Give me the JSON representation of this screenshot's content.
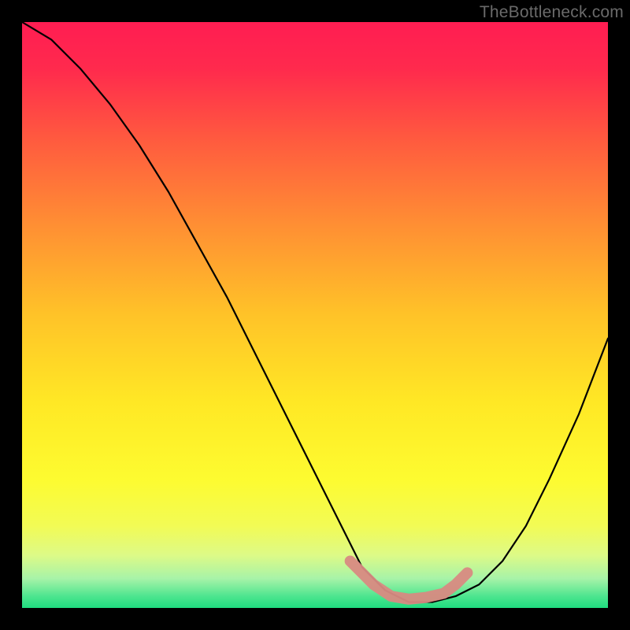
{
  "watermark": "TheBottleneck.com",
  "chart_data": {
    "type": "line",
    "title": "",
    "xlabel": "",
    "ylabel": "",
    "xlim": [
      0,
      100
    ],
    "ylim": [
      0,
      100
    ],
    "grid": false,
    "legend": false,
    "background_gradient": {
      "stops": [
        {
          "offset": 0,
          "color": "#ff1d52"
        },
        {
          "offset": 8,
          "color": "#ff2a4d"
        },
        {
          "offset": 20,
          "color": "#ff5a3f"
        },
        {
          "offset": 35,
          "color": "#ff9033"
        },
        {
          "offset": 50,
          "color": "#ffc328"
        },
        {
          "offset": 65,
          "color": "#ffe825"
        },
        {
          "offset": 78,
          "color": "#fdfb30"
        },
        {
          "offset": 86,
          "color": "#f2fb55"
        },
        {
          "offset": 91,
          "color": "#ddfa87"
        },
        {
          "offset": 95,
          "color": "#a7f3a8"
        },
        {
          "offset": 98,
          "color": "#4de58f"
        },
        {
          "offset": 100,
          "color": "#1fdc7f"
        }
      ]
    },
    "series": [
      {
        "name": "bottleneck-curve",
        "x": [
          0,
          5,
          10,
          15,
          20,
          25,
          30,
          35,
          40,
          45,
          50,
          55,
          58,
          62,
          66,
          70,
          74,
          78,
          82,
          86,
          90,
          95,
          100
        ],
        "values": [
          100,
          97,
          92,
          86,
          79,
          71,
          62,
          53,
          43,
          33,
          23,
          13,
          7,
          3,
          1,
          1,
          2,
          4,
          8,
          14,
          22,
          33,
          46
        ]
      },
      {
        "name": "optimal-zone",
        "type": "highlight",
        "color": "#d88a82",
        "x": [
          56,
          58,
          60,
          63,
          66,
          69,
          72,
          74,
          76
        ],
        "values": [
          8,
          6,
          4,
          2,
          1.5,
          1.8,
          2.5,
          4,
          6
        ]
      }
    ],
    "annotations": []
  }
}
